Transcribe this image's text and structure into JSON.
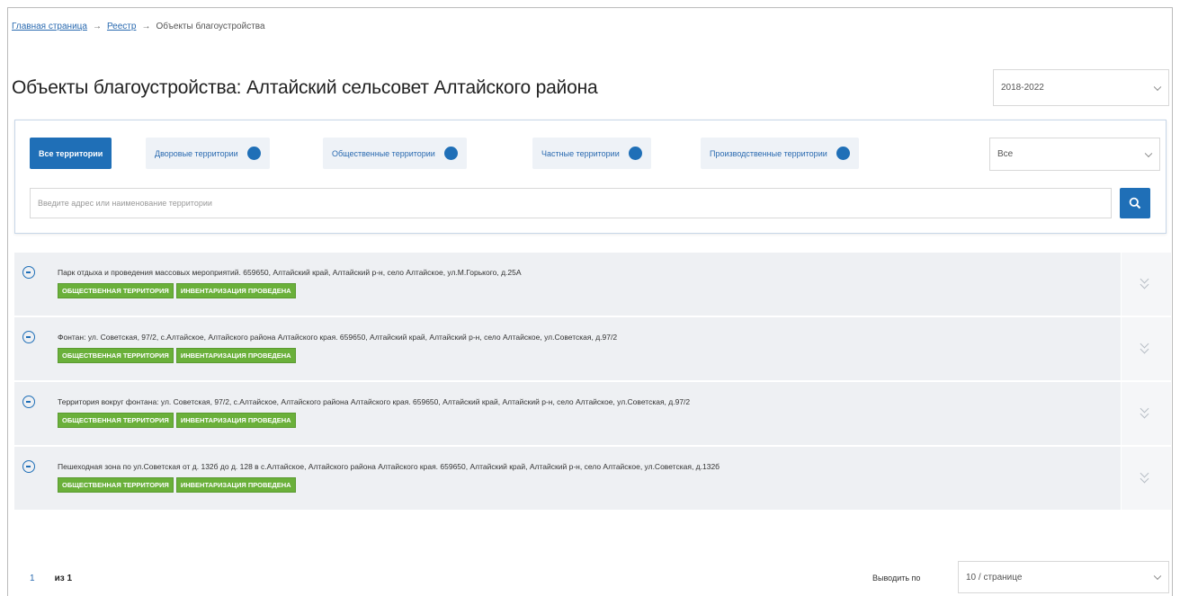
{
  "breadcrumb": {
    "items": [
      "Главная страница",
      "Реестр",
      "Объекты благоустройства"
    ],
    "separator": "→"
  },
  "page": {
    "title": "Объекты благоустройства: Алтайский сельсовет Алтайского района"
  },
  "year_select": {
    "value": "2018-2022"
  },
  "tabs": [
    {
      "label": "Все территории",
      "active": true
    },
    {
      "label": "Дворовые территории",
      "active": false
    },
    {
      "label": "Общественные территории",
      "active": false
    },
    {
      "label": "Частные территории",
      "active": false
    },
    {
      "label": "Производственные территории",
      "active": false
    }
  ],
  "kind_select": {
    "value": "Все"
  },
  "search": {
    "placeholder": "Введите адрес или наименование территории"
  },
  "items": [
    {
      "text": "Парк отдыха и проведения массовых мероприятий. 659650, Алтайский край, Алтайский р-н, село Алтайское, ул.М.Горького, д.25А",
      "badges": [
        "ОБЩЕСТВЕННАЯ ТЕРРИТОРИЯ",
        "ИНВЕНТАРИЗАЦИЯ ПРОВЕДЕНА"
      ]
    },
    {
      "text": "Фонтан: ул. Советская, 97/2, с.Алтайское, Алтайского района Алтайского края. 659650, Алтайский край, Алтайский р-н, село Алтайское, ул.Советская, д.97/2",
      "badges": [
        "ОБЩЕСТВЕННАЯ ТЕРРИТОРИЯ",
        "ИНВЕНТАРИЗАЦИЯ ПРОВЕДЕНА"
      ]
    },
    {
      "text": "Территория вокруг фонтана: ул. Советская, 97/2, с.Алтайское, Алтайского района Алтайского края. 659650, Алтайский край, Алтайский р-н, село Алтайское, ул.Советская, д.97/2",
      "badges": [
        "ОБЩЕСТВЕННАЯ ТЕРРИТОРИЯ",
        "ИНВЕНТАРИЗАЦИЯ ПРОВЕДЕНА"
      ]
    },
    {
      "text": "Пешеходная зона по ул.Советская от д. 132б до д. 128 в с.Алтайское, Алтайского района Алтайского края. 659650, Алтайский край, Алтайский р-н, село Алтайское, ул.Советская, д.132б",
      "badges": [
        "ОБЩЕСТВЕННАЯ ТЕРРИТОРИЯ",
        "ИНВЕНТАРИЗАЦИЯ ПРОВЕДЕНА"
      ]
    }
  ],
  "pager": {
    "current": "1",
    "of": "из 1"
  },
  "perpage": {
    "label": "Выводить по",
    "value": "10 / странице"
  },
  "colors": {
    "accent": "#1f6fb7",
    "badge": "#6ab03a",
    "row_bg": "#eef0f3"
  },
  "icons": [
    "collapse-circle-icon",
    "chevron-down-icon",
    "search-icon",
    "double-chevron-down-icon"
  ]
}
